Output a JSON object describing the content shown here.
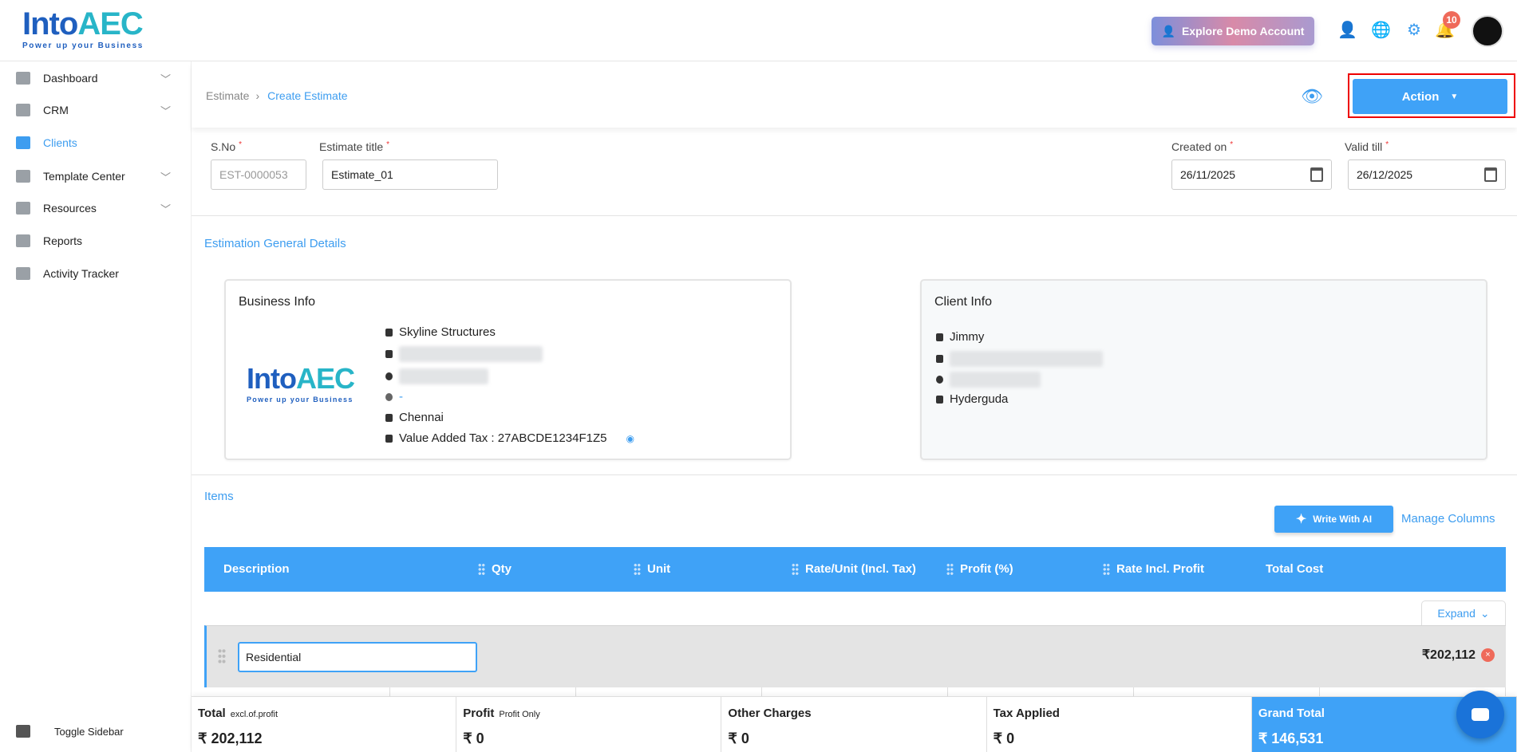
{
  "header": {
    "logo_text_main": "Into",
    "logo_text_accent": "AEC",
    "logo_tagline": "Power up your Business",
    "demo_button": "Explore Demo Account",
    "notification_count": "10"
  },
  "sidebar": {
    "items": [
      {
        "label": "Dashboard"
      },
      {
        "label": "CRM"
      },
      {
        "label": "Clients"
      },
      {
        "label": "Template Center"
      },
      {
        "label": "Resources"
      },
      {
        "label": "Reports"
      },
      {
        "label": "Activity Tracker"
      }
    ],
    "toggle": "Toggle Sidebar"
  },
  "breadcrumb": {
    "parent": "Estimate",
    "current": "Create Estimate"
  },
  "action_label": "Action",
  "form": {
    "sno_label": "S.No",
    "sno_value": "EST-0000053",
    "title_label": "Estimate title",
    "title_value": "Estimate_01",
    "created_label": "Created on",
    "created_value": "26/11/2025",
    "valid_label": "Valid till",
    "valid_value": "26/12/2025",
    "required_mark": "*"
  },
  "general_title": "Estimation General Details",
  "business": {
    "title": "Business Info",
    "name": "Skyline Structures",
    "website": "-",
    "city": "Chennai",
    "vat": "Value Added Tax : 27ABCDE1234F1Z5"
  },
  "client": {
    "title": "Client Info",
    "name": "Jimmy",
    "address": "Hyderguda"
  },
  "items": {
    "title": "Items",
    "write_ai": "Write With AI",
    "manage_columns": "Manage Columns",
    "columns": [
      "Description",
      "Qty",
      "Unit",
      "Rate/Unit (Incl. Tax)",
      "Profit (%)",
      "Rate Incl. Profit",
      "Total Cost"
    ],
    "expand": "Expand",
    "group_name": "Residential",
    "group_total": "₹202,112"
  },
  "footer": [
    {
      "label": "Total",
      "sub": "excl.of.profit",
      "value": "₹ 202,112"
    },
    {
      "label": "Profit",
      "sub": "Profit Only",
      "value": "₹ 0"
    },
    {
      "label": "Other Charges",
      "sub": "",
      "value": "₹ 0"
    },
    {
      "label": "Tax Applied",
      "sub": "",
      "value": "₹ 0"
    },
    {
      "label": "Grand Total",
      "sub": "",
      "value": "₹ 146,531"
    }
  ]
}
